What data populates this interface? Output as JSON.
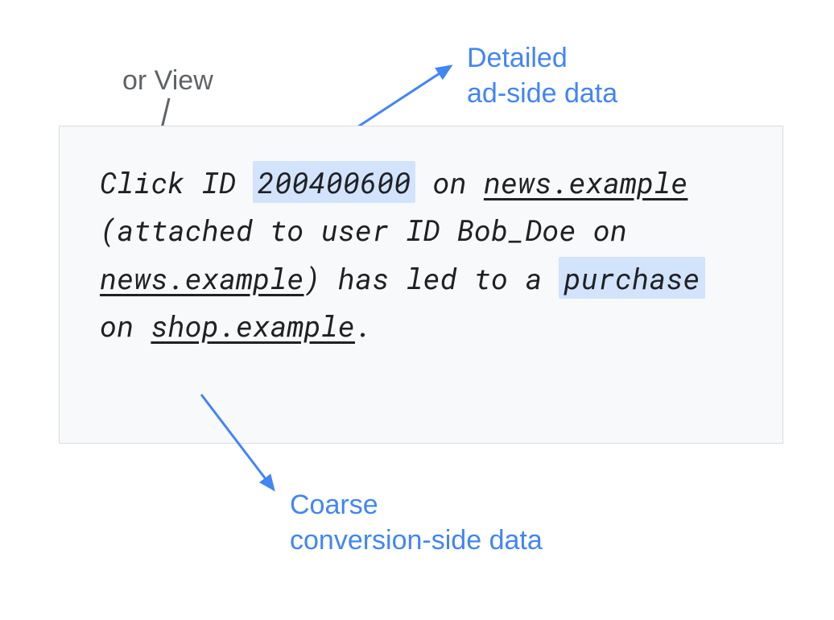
{
  "annotations": {
    "orView": "or View",
    "detailedLine1": "Detailed",
    "detailedLine2": "ad-side data",
    "coarseLine1": "Coarse",
    "coarseLine2": "conversion-side data"
  },
  "content": {
    "pre1": "Click ID ",
    "clickId": "200400600",
    "post1": " on ",
    "site1": "news.example",
    "mid1": " (attached to user ID Bob_Doe on ",
    "site1b": "news.example",
    "mid2": ") has led to a ",
    "purchase": "purchase",
    "mid3": " on ",
    "site2": "shop.example",
    "end": "."
  }
}
